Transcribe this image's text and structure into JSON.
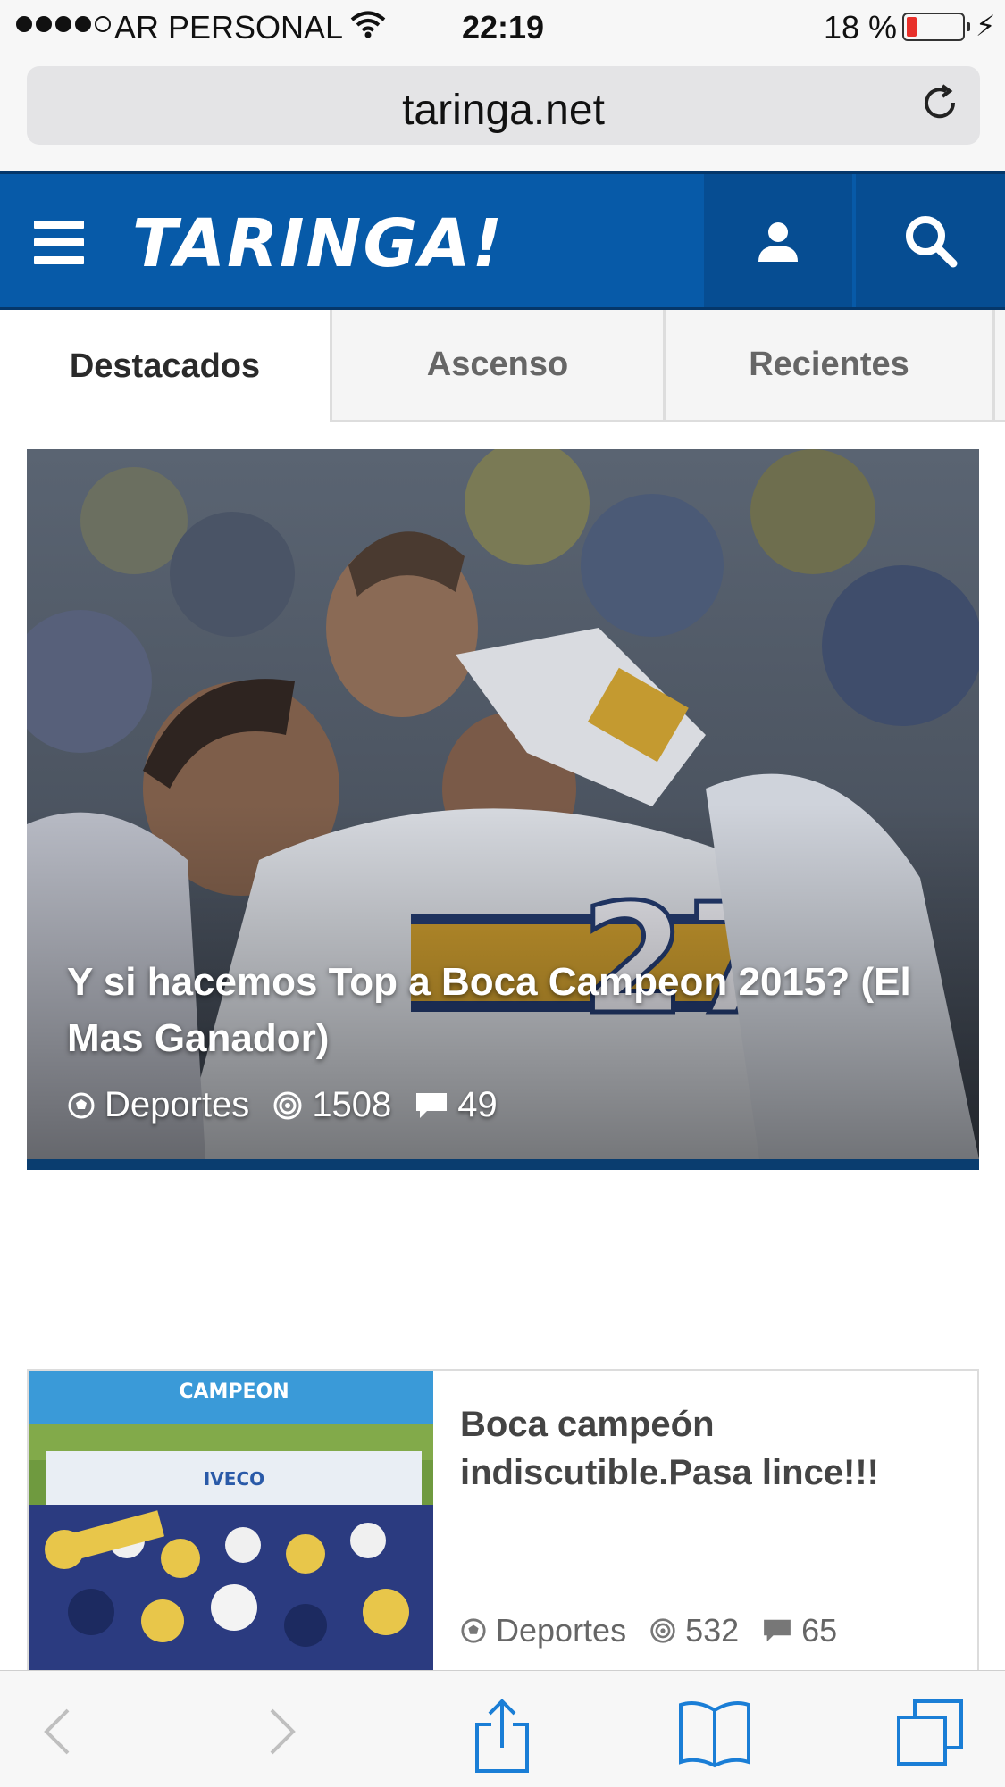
{
  "status_bar": {
    "carrier": "AR PERSONAL",
    "time": "22:19",
    "battery_percent": "18 %",
    "battery_level": 0.18
  },
  "browser": {
    "url": "taringa.net"
  },
  "header": {
    "logo": "TARINGA!"
  },
  "tabs": [
    {
      "label": "Destacados",
      "active": true
    },
    {
      "label": "Ascenso",
      "active": false
    },
    {
      "label": "Recientes",
      "active": false
    }
  ],
  "featured_post": {
    "title": "Y si hacemos Top a Boca Campeon 2015? (El Mas Ganador)",
    "category": "Deportes",
    "points": "1508",
    "comments": "49"
  },
  "posts": [
    {
      "title": "Boca campeón indiscutible.Pasa lince!!!",
      "category": "Deportes",
      "points": "532",
      "comments": "65"
    }
  ],
  "colors": {
    "brand_blue": "#075aa8",
    "brand_dark": "#064d92",
    "ios_blue": "#1a7ed6"
  }
}
